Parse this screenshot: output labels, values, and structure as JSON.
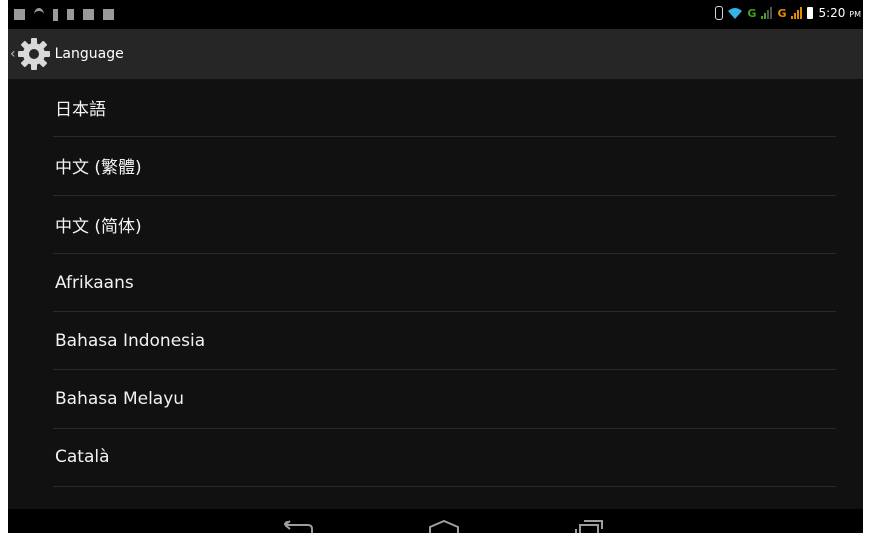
{
  "status_bar": {
    "left_icons": [
      "notification-icon",
      "wifi-notification-icon",
      "usb-icon",
      "lock-icon",
      "notification-icon",
      "stop-icon"
    ],
    "network_labels": [
      "G",
      "G"
    ],
    "time": "5:20",
    "ampm": "PM"
  },
  "action_bar": {
    "title": "Language",
    "icon": "gear-icon"
  },
  "languages": [
    "日本語",
    "中文 (繁體)",
    "中文 (简体)",
    "Afrikaans",
    "Bahasa Indonesia",
    "Bahasa Melayu",
    "Català"
  ],
  "colors": {
    "action_bar_bg": "#262626",
    "list_bg": "#111111",
    "divider": "#2a2a2a",
    "text": "#f2f2f2",
    "signal_green": "#3fa51f",
    "signal_orange": "#e68a00",
    "wifi_blue": "#33b5e5"
  }
}
